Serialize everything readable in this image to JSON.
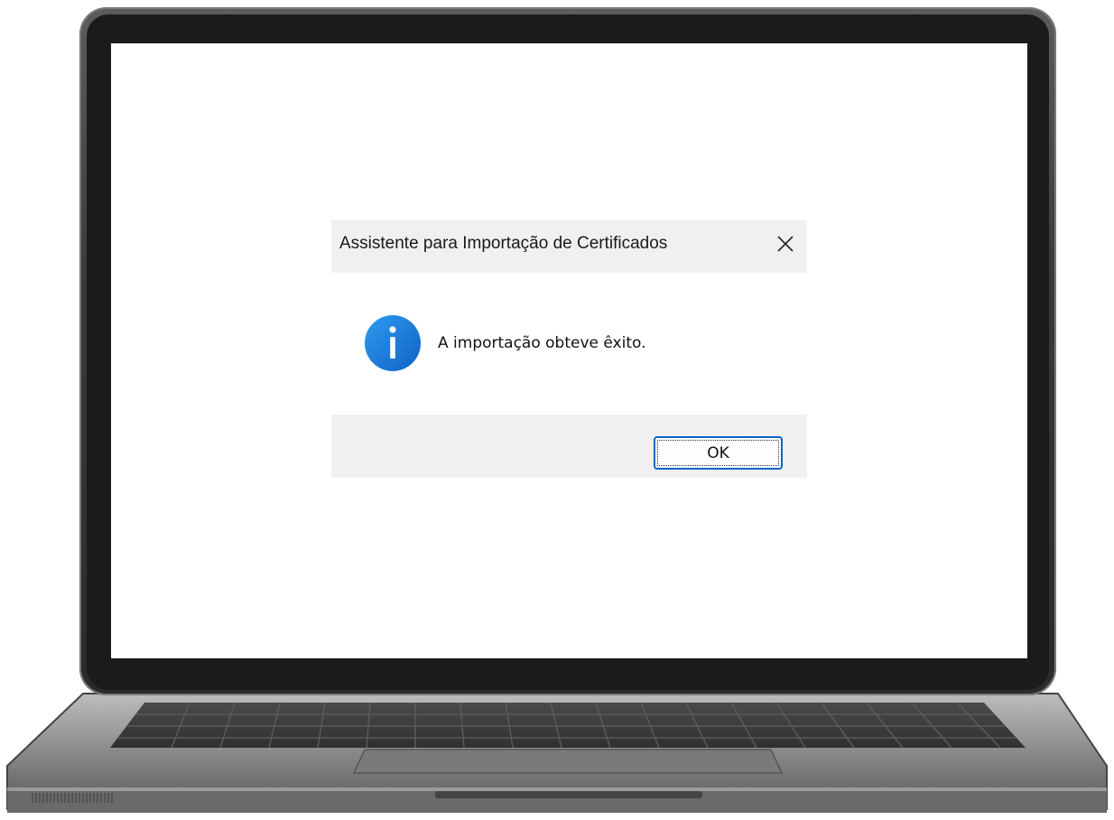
{
  "dialog": {
    "title": "Assistente para Importação de Certificados",
    "message": "A importação obteve êxito.",
    "icon": "info-icon",
    "ok_label": "OK",
    "close_icon": "close-icon"
  },
  "colors": {
    "accent": "#0a64c8",
    "titlebar_bg": "#f0f0f0",
    "info_icon_blue": "#1a7ad9"
  }
}
